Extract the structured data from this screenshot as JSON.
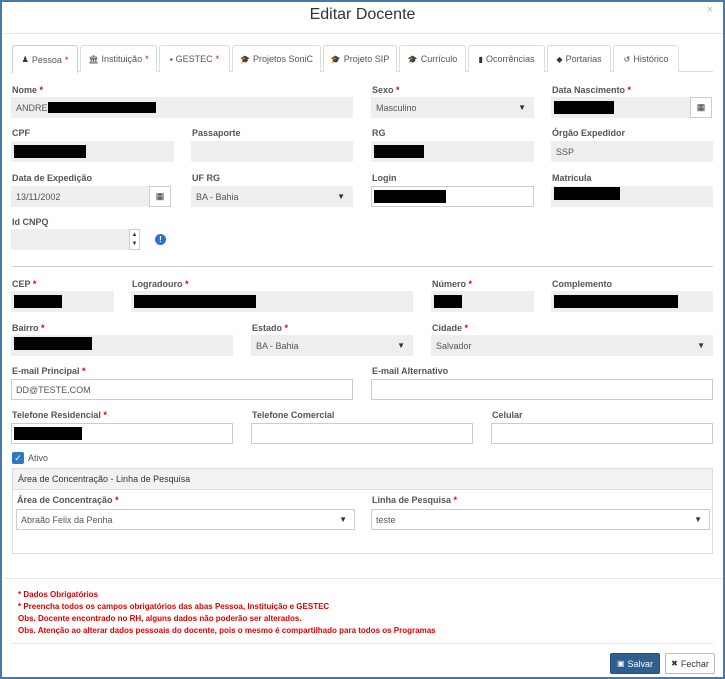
{
  "modal": {
    "title": "Editar Docente",
    "close": "×"
  },
  "tabs": [
    {
      "label": "Pessoa",
      "icon": "user-icon",
      "required": true
    },
    {
      "label": "Instituição",
      "icon": "institution-icon",
      "required": true
    },
    {
      "label": "GESTEC",
      "icon": "briefcase-icon",
      "required": true
    },
    {
      "label": "Projetos SoniC",
      "icon": "graduation-cap-icon",
      "required": false
    },
    {
      "label": "Projeto SIP",
      "icon": "graduation-cap-icon",
      "required": false
    },
    {
      "label": "Currículo",
      "icon": "graduation-cap-icon",
      "required": false
    },
    {
      "label": "Ocorrências",
      "icon": "book-icon",
      "required": false
    },
    {
      "label": "Portarias",
      "icon": "tag-icon",
      "required": false
    },
    {
      "label": "Histórico",
      "icon": "history-icon",
      "required": false
    }
  ],
  "form": {
    "nome": {
      "label": "Nome",
      "value": "ANDRE"
    },
    "sexo": {
      "label": "Sexo",
      "value": "Masculino"
    },
    "data_nascimento": {
      "label": "Data Nascimento"
    },
    "cpf": {
      "label": "CPF"
    },
    "passaporte": {
      "label": "Passaporte"
    },
    "rg": {
      "label": "RG"
    },
    "orgao_expedidor": {
      "label": "Órgão Expedidor",
      "value": "SSP"
    },
    "data_expedicao": {
      "label": "Data de Expedição",
      "value": "13/11/2002"
    },
    "uf_rg": {
      "label": "UF RG",
      "value": "BA - Bahia"
    },
    "login": {
      "label": "Login"
    },
    "matricula": {
      "label": "Matrícula"
    },
    "id_cnpq": {
      "label": "Id CNPQ"
    },
    "cep": {
      "label": "CEP"
    },
    "logradouro": {
      "label": "Logradouro"
    },
    "numero": {
      "label": "Número"
    },
    "complemento": {
      "label": "Complemento"
    },
    "bairro": {
      "label": "Bairro"
    },
    "estado": {
      "label": "Estado",
      "value": "BA - Bahia"
    },
    "cidade": {
      "label": "Cidade",
      "value": "Salvador"
    },
    "email_principal": {
      "label": "E-mail Principal",
      "value": "DD@TESTE.COM"
    },
    "email_alternativo": {
      "label": "E-mail Alternativo"
    },
    "telefone_residencial": {
      "label": "Telefone Residencial"
    },
    "telefone_comercial": {
      "label": "Telefone Comercial"
    },
    "celular": {
      "label": "Celular"
    },
    "ativo": {
      "label": "Ativo",
      "checked": true
    }
  },
  "area_panel": {
    "title": "Área de Concentração - Linha de Pesquisa",
    "area": {
      "label": "Área de Concentração",
      "value": "Abraão Felix da Penha"
    },
    "linha": {
      "label": "Linha de Pesquisa",
      "value": "teste"
    }
  },
  "notes": [
    "* Dados Obrigatórios",
    "* Preencha todos os campos obrigatórios das abas Pessoa, Instituição e GESTEC",
    "Obs. Docente encontrado no RH, alguns dados não poderão ser alterados.",
    "Obs. Atenção ao alterar dados pessoais do docente, pois o mesmo é compartilhado para todos os Programas"
  ],
  "buttons": {
    "save": "Salvar",
    "close": "Fechar"
  },
  "symbols": {
    "required": "*",
    "caret": "▼",
    "calendar": "▦",
    "check": "✓",
    "info": "!",
    "spin_up": "▲",
    "spin_down": "▼",
    "save_icon": "💾",
    "close_icon": "✖"
  },
  "colors": {
    "accent": "#2e5f8f",
    "required": "#dd0000",
    "border": "#4a78a8"
  }
}
